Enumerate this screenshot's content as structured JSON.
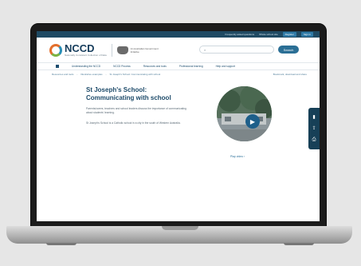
{
  "utility_bar": {
    "items": [
      "Frequently asked questions",
      "Whole school site",
      "Register",
      "Sign in"
    ]
  },
  "header": {
    "logo": "NCCD",
    "logo_sub": "Nationally Consistent Collection of Data",
    "gov_text": "An Australian Government Initiative",
    "search_placeholder": "",
    "search_button": "Search"
  },
  "nav": {
    "items": [
      "Understanding the NCCD",
      "NCCD Process",
      "Resources and tools",
      "Professional learning",
      "Help and support"
    ]
  },
  "breadcrumb": {
    "items": [
      "Resources and tools",
      "Illustrative examples",
      "St Joseph's School: Communicating with school"
    ],
    "share": "Bookmark, download and share"
  },
  "main": {
    "title": "St Joseph's School: Communicating with school",
    "para1": "Parents/carers, teachers and school leaders discuss the importance of communicating about students' learning.",
    "para2": "St Joseph's School is a Catholic school in a city in the south of Western Australia.",
    "video_label": "Play video"
  },
  "tools": {
    "icons": [
      "bookmark-icon",
      "share-icon",
      "print-icon"
    ]
  },
  "colors": {
    "brand_dark": "#1e4b6a",
    "accent": "#2b6f95",
    "logo_orange": "#e36f2c",
    "logo_green": "#7bb342"
  }
}
